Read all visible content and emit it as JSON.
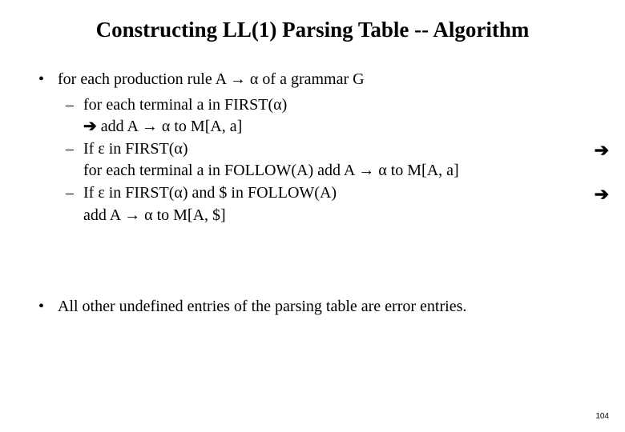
{
  "title": "Constructing LL(1) Parsing Table -- Algorithm",
  "bullet1_intro": "for each production rule A → α  of a grammar G",
  "sub1": "for each terminal a in FIRST(α)",
  "sub1_action_arrow": "➔",
  "sub1_action": "  add A → α  to M[A, a]",
  "sub2": "If ε in FIRST(α)",
  "sub2_right_arrow": "➔",
  "sub2_cont": "for each terminal a in FOLLOW(A)  add A → α  to M[A, a]",
  "sub3": "If ε in FIRST(α) and $ in FOLLOW(A)",
  "sub3_right_arrow": "➔",
  "sub3_cont": "add A → α  to M[A, $]",
  "footnote": "All other undefined entries of the parsing table are error entries.",
  "page_number": "104",
  "bullet_marker": "•",
  "dash_marker": "–"
}
